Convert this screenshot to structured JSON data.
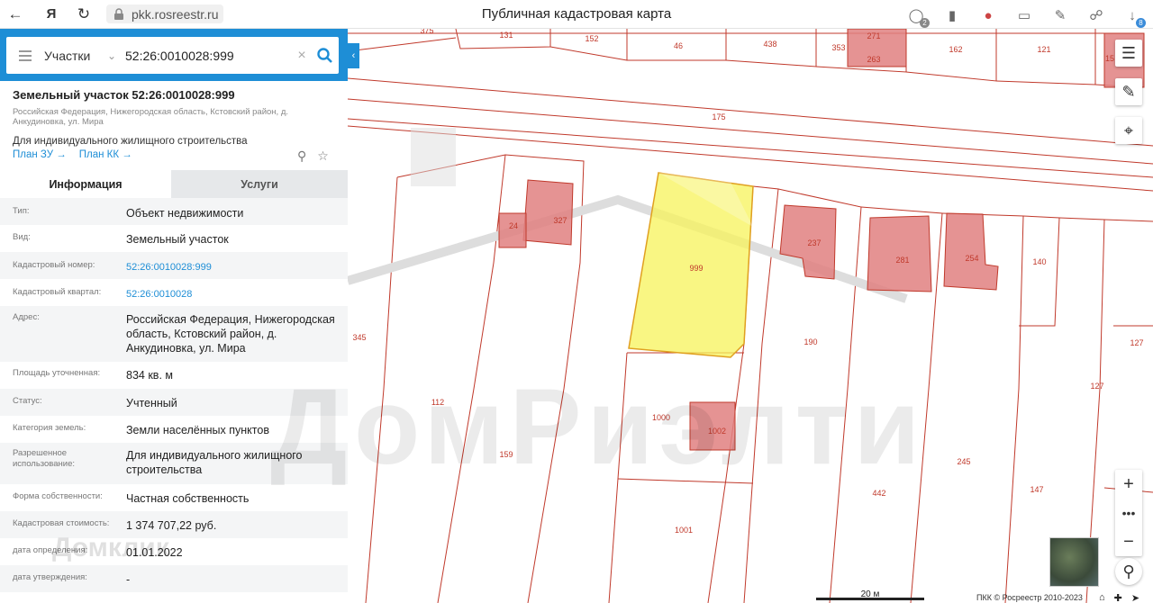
{
  "browser": {
    "url": "pkk.rosreestr.ru",
    "title": "Публичная кадастровая карта",
    "badges": [
      "2",
      "8"
    ]
  },
  "search": {
    "category": "Участки",
    "query": "52:26:0010028:999"
  },
  "object": {
    "title": "Земельный участок 52:26:0010028:999",
    "address_short": "Российская Федерация, Нижегородская область, Кстовский район, д. Анкудиновка, ул. Мира",
    "use": "Для индивидуального жилищного строительства",
    "links": {
      "plan_zu": "План ЗУ",
      "plan_kk": "План КК"
    }
  },
  "tabs": {
    "info": "Информация",
    "services": "Услуги"
  },
  "rows": [
    {
      "k": "Тип:",
      "v": "Объект недвижимости"
    },
    {
      "k": "Вид:",
      "v": "Земельный участок"
    },
    {
      "k": "Кадастровый номер:",
      "v": "52:26:0010028:999"
    },
    {
      "k": "Кадастровый квартал:",
      "v": "52:26:0010028"
    },
    {
      "k": "Адрес:",
      "v": "Российская Федерация, Нижегородская область, Кстовский район, д. Анкудиновка, ул. Мира"
    },
    {
      "k": "Площадь уточненная:",
      "v": "834 кв. м"
    },
    {
      "k": "Статус:",
      "v": "Учтенный"
    },
    {
      "k": "Категория земель:",
      "v": "Земли населённых пунктов"
    },
    {
      "k": "Разрешенное использование:",
      "v": "Для индивидуального жилищного строительства"
    },
    {
      "k": "Форма собственности:",
      "v": "Частная собственность"
    },
    {
      "k": "Кадастровая стоимость:",
      "v": "1 374 707,22 руб."
    },
    {
      "k": "дата определения:",
      "v": "01.01.2022"
    },
    {
      "k": "дата утверждения:",
      "v": "-"
    }
  ],
  "map": {
    "labels": [
      "375",
      "131",
      "152",
      "46",
      "438",
      "353",
      "271",
      "263",
      "162",
      "121",
      "15",
      "175",
      "327",
      "24",
      "237",
      "281",
      "254",
      "140",
      "999",
      "345",
      "190",
      "127",
      "112",
      "1000",
      "1002",
      "127",
      "159",
      "245",
      "442",
      "147",
      "1001"
    ],
    "scale": "20 м",
    "copyright": "ПКК © Росреестр 2010-2023"
  },
  "watermark": "ДомРиэлти",
  "watermark2": "Домклик",
  "colors": {
    "accent": "#1e8ed6",
    "parcel_line": "#c0392b",
    "selected": "#f7f35a",
    "building": "#e08080"
  }
}
